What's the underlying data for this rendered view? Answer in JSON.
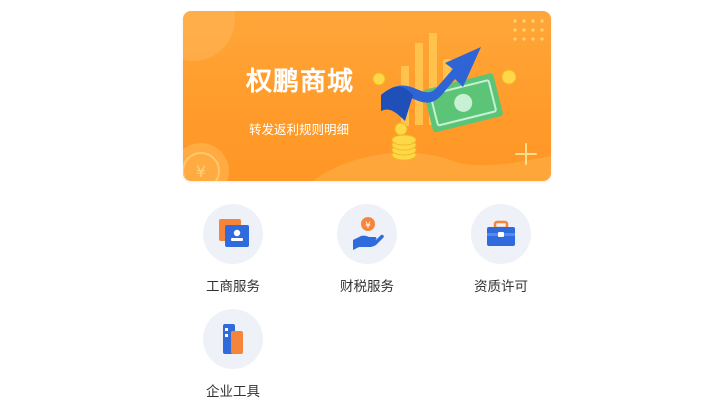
{
  "banner": {
    "title": "权鹏商城",
    "subtitle": "转发返利规则明细",
    "accent_color": "#ff9b2a",
    "illustration": "growth-chart-arrow-money-illustration"
  },
  "services": [
    {
      "label": "工商服务",
      "icon": "id-card-icon"
    },
    {
      "label": "财税服务",
      "icon": "hand-coin-icon"
    },
    {
      "label": "资质许可",
      "icon": "briefcase-icon"
    },
    {
      "label": "企业工具",
      "icon": "tool-panel-icon"
    }
  ],
  "colors": {
    "icon_blue": "#2f6bdc",
    "icon_orange": "#f5853a",
    "icon_bg": "#eef1f7",
    "label_text": "#333333"
  }
}
